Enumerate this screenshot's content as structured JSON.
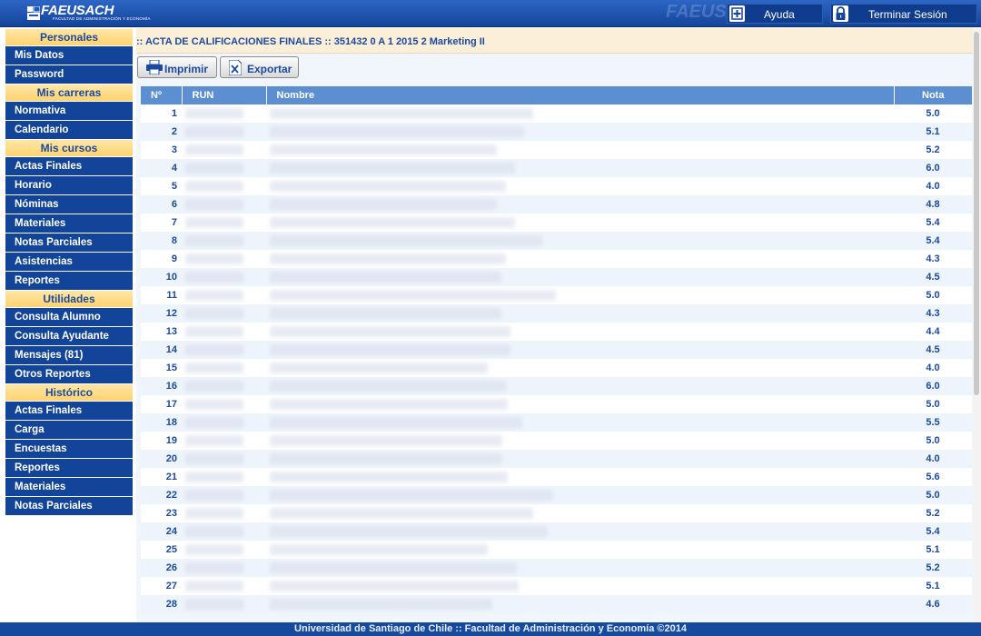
{
  "header": {
    "logo": "FAEUSACH",
    "logo_sub": "FACULTAD DE ADMINISTRACIÓN Y ECONOMÍA",
    "watermark": "FAEUSACH",
    "help_label": "Ayuda",
    "logout_label": "Terminar Sesión"
  },
  "sidebar": {
    "sections": [
      {
        "title": "Personales",
        "items": [
          "Mis Datos",
          "Password"
        ]
      },
      {
        "title": "Mis carreras",
        "items": [
          "Normativa",
          "Calendario"
        ]
      },
      {
        "title": "Mis cursos",
        "items": [
          "Actas Finales",
          "Horario",
          "Nóminas",
          "Materiales",
          "Notas Parciales",
          "Asistencias",
          "Reportes"
        ]
      },
      {
        "title": "Utilidades",
        "items": [
          "Consulta Alumno",
          "Consulta Ayudante",
          "Mensajes (81)",
          "Otros Reportes"
        ]
      },
      {
        "title": "Histórico",
        "items": [
          "Actas Finales",
          "Carga",
          "Encuestas",
          "Reportes",
          "Materiales",
          "Notas Parciales"
        ]
      }
    ]
  },
  "main": {
    "title": ":: ACTA DE CALIFICACIONES FINALES :: 351432 0 A 1 2015 2 Marketing II",
    "print_label": "Imprimir",
    "export_label": "Exportar",
    "table": {
      "headers": {
        "num": "Nº",
        "run": "RUN",
        "name": "Nombre",
        "grade": "Nota"
      },
      "rows": [
        {
          "num": "1",
          "grade": "5.0"
        },
        {
          "num": "2",
          "grade": "5.1"
        },
        {
          "num": "3",
          "grade": "5.2"
        },
        {
          "num": "4",
          "grade": "6.0"
        },
        {
          "num": "5",
          "grade": "4.0"
        },
        {
          "num": "6",
          "grade": "4.8"
        },
        {
          "num": "7",
          "grade": "5.4"
        },
        {
          "num": "8",
          "grade": "5.4"
        },
        {
          "num": "9",
          "grade": "4.3"
        },
        {
          "num": "10",
          "grade": "4.5"
        },
        {
          "num": "11",
          "grade": "5.0"
        },
        {
          "num": "12",
          "grade": "4.3"
        },
        {
          "num": "13",
          "grade": "4.4"
        },
        {
          "num": "14",
          "grade": "4.5"
        },
        {
          "num": "15",
          "grade": "4.0"
        },
        {
          "num": "16",
          "grade": "6.0"
        },
        {
          "num": "17",
          "grade": "5.0"
        },
        {
          "num": "18",
          "grade": "5.5"
        },
        {
          "num": "19",
          "grade": "5.0"
        },
        {
          "num": "20",
          "grade": "4.0"
        },
        {
          "num": "21",
          "grade": "5.6"
        },
        {
          "num": "22",
          "grade": "5.0"
        },
        {
          "num": "23",
          "grade": "5.2"
        },
        {
          "num": "24",
          "grade": "5.4"
        },
        {
          "num": "25",
          "grade": "5.1"
        },
        {
          "num": "26",
          "grade": "5.2"
        },
        {
          "num": "27",
          "grade": "5.1"
        },
        {
          "num": "28",
          "grade": "4.6"
        }
      ]
    }
  },
  "footer": {
    "text": "Universidad de Santiago de Chile :: Facultad de Administración y Economía ©2014"
  }
}
